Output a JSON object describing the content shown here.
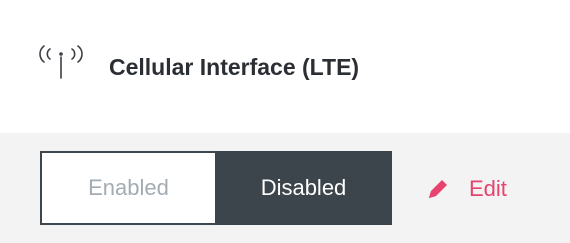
{
  "header": {
    "title": "Cellular Interface (LTE)",
    "icon": "antenna-signal-icon"
  },
  "toggle": {
    "enabled_label": "Enabled",
    "disabled_label": "Disabled",
    "selected": "Disabled"
  },
  "actions": {
    "edit_label": "Edit",
    "edit_icon": "pencil-icon"
  },
  "colors": {
    "accent": "#e8426f",
    "toggle_active_bg": "#3c444c",
    "toggle_inactive_text": "#a3abb3",
    "page_bg": "#f3f3f4",
    "header_bg": "#ffffff",
    "title_text": "#2b2f33"
  }
}
